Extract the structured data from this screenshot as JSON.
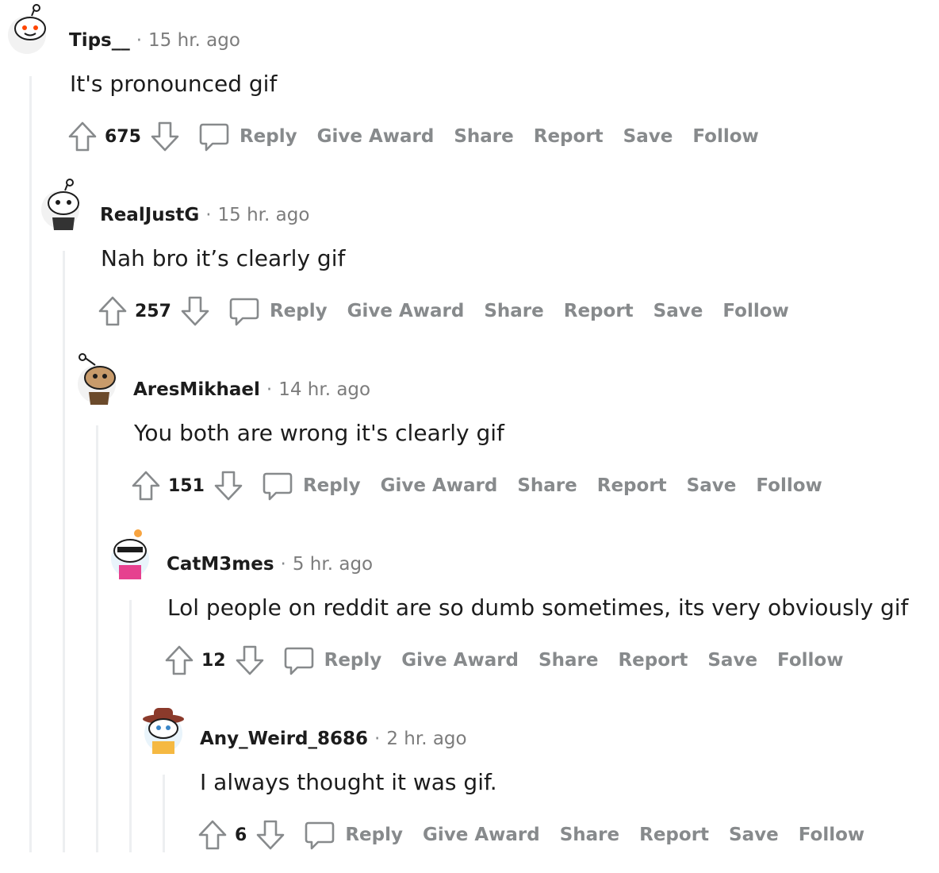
{
  "thread": {
    "comments": [
      {
        "avatar_icon": "snoo-avatar-icon",
        "username": "Tips__",
        "separator": "·",
        "time": "15 hr. ago",
        "text": "It's pronounced gif",
        "score": "675",
        "actions": [
          "Reply",
          "Give Award",
          "Share",
          "Report",
          "Save",
          "Follow"
        ]
      },
      {
        "avatar_icon": "snoo-avatar-icon",
        "username": "RealJustG",
        "separator": "·",
        "time": "15 hr. ago",
        "text": "Nah bro it’s clearly gif",
        "score": "257",
        "actions": [
          "Reply",
          "Give Award",
          "Share",
          "Report",
          "Save",
          "Follow"
        ]
      },
      {
        "avatar_icon": "snoo-avatar-icon",
        "username": "AresMikhael",
        "separator": "·",
        "time": "14 hr. ago",
        "text": "You both are wrong it's clearly gif",
        "score": "151",
        "actions": [
          "Reply",
          "Give Award",
          "Share",
          "Report",
          "Save",
          "Follow"
        ]
      },
      {
        "avatar_icon": "snoo-avatar-icon",
        "username": "CatM3mes",
        "separator": "·",
        "time": "5 hr. ago",
        "text": "Lol people on reddit are so dumb sometimes, its very obviously gif",
        "score": "12",
        "actions": [
          "Reply",
          "Give Award",
          "Share",
          "Report",
          "Save",
          "Follow"
        ]
      },
      {
        "avatar_icon": "snoo-avatar-icon",
        "username": "Any_Weird_8686",
        "separator": "·",
        "time": "2 hr. ago",
        "text": "I always thought it was gif.",
        "score": "6",
        "actions": [
          "Reply",
          "Give Award",
          "Share",
          "Report",
          "Save",
          "Follow"
        ]
      }
    ]
  },
  "colors": {
    "username": "#1c1c1c",
    "meta": "#7c7c7c",
    "action": "#878a8c",
    "thread_line": "#edeff1"
  },
  "icons": {
    "upvote": "upvote-arrow-icon",
    "downvote": "downvote-arrow-icon",
    "reply": "comment-bubble-icon"
  }
}
